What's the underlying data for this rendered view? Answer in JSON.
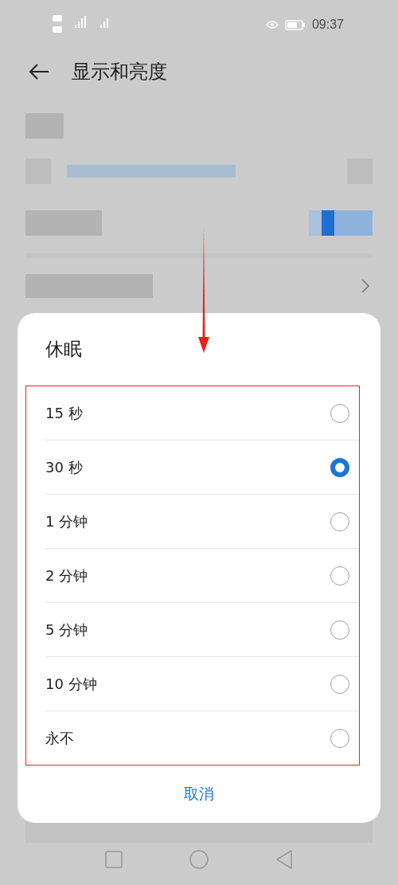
{
  "status_bar": {
    "time": "09:37"
  },
  "header": {
    "title": "显示和亮度"
  },
  "dialog": {
    "title": "休眠",
    "options": [
      {
        "label": "15 秒",
        "selected": false
      },
      {
        "label": "30 秒",
        "selected": true
      },
      {
        "label": "1 分钟",
        "selected": false
      },
      {
        "label": "2 分钟",
        "selected": false
      },
      {
        "label": "5 分钟",
        "selected": false
      },
      {
        "label": "10 分钟",
        "selected": false
      },
      {
        "label": "永不",
        "selected": false
      }
    ],
    "cancel": "取消"
  }
}
